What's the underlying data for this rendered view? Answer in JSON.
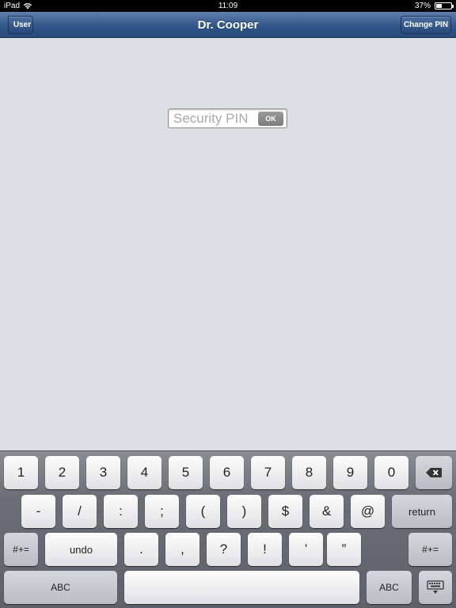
{
  "status_bar": {
    "device": "iPad",
    "time": "11:09",
    "battery": "37%",
    "battery_level": 0.37
  },
  "nav": {
    "back_label": "User",
    "title": "Dr. Cooper",
    "right_label": "Change PIN"
  },
  "pin": {
    "placeholder": "Security PIN",
    "value": "",
    "ok_label": "OK"
  },
  "keyboard": {
    "row1": [
      "1",
      "2",
      "3",
      "4",
      "5",
      "6",
      "7",
      "8",
      "9",
      "0"
    ],
    "row2": [
      "-",
      "/",
      ":",
      ";",
      "(",
      ")",
      "$",
      "&",
      "@"
    ],
    "return_label": "return",
    "symbols_label": "#+=",
    "undo_label": "undo",
    "row3": [
      ".",
      ",",
      "?",
      "!",
      "’",
      "”"
    ],
    "abc_label": "ABC",
    "icons": {
      "delete": "delete-icon",
      "hide": "keyboard-hide-icon"
    }
  },
  "colors": {
    "nav_bar": "#2e5385",
    "background": "#dcdfe4"
  }
}
